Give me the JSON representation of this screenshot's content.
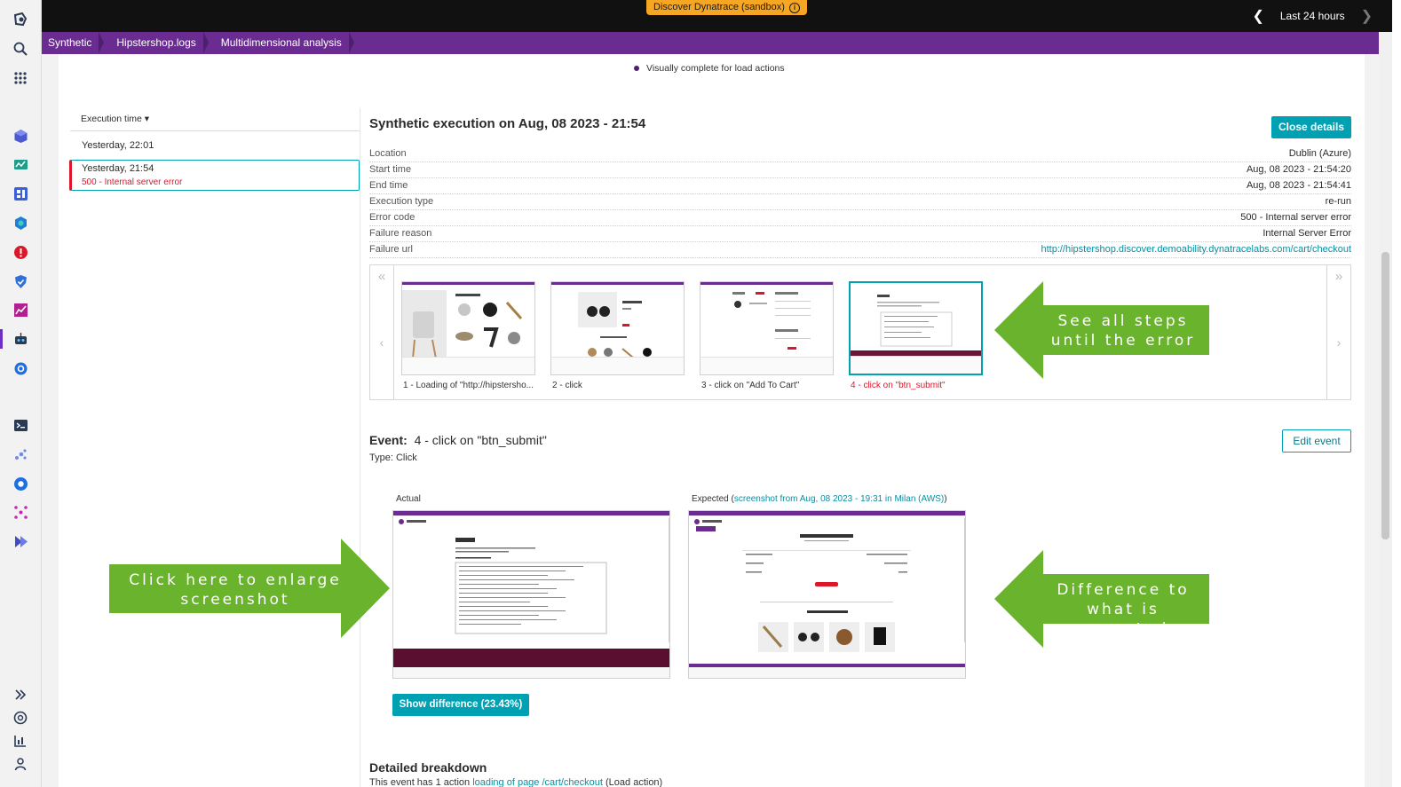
{
  "topbar": {
    "banner_label": "Discover Dynatrace (sandbox)",
    "timeframe_label": "Last 24 hours"
  },
  "breadcrumb": [
    "Synthetic",
    "Hipstershop.logs",
    "Multidimensional analysis"
  ],
  "legend": {
    "label": "Visually complete for load actions"
  },
  "execution_list": {
    "sort_label": "Execution time ▾",
    "items": [
      {
        "time": "Yesterday, 22:01",
        "status": ""
      },
      {
        "time": "Yesterday, 21:54",
        "status": "500 - Internal server error",
        "selected": true
      }
    ]
  },
  "details": {
    "title": "Synthetic execution on Aug, 08 2023 - 21:54",
    "close_button": "Close details",
    "rows": [
      {
        "label": "Location",
        "value": "Dublin (Azure)"
      },
      {
        "label": "Start time",
        "value": "Aug, 08 2023 - 21:54:20"
      },
      {
        "label": "End time",
        "value": "Aug, 08 2023 - 21:54:41"
      },
      {
        "label": "Execution type",
        "value": "re-run"
      },
      {
        "label": "Error code",
        "value": "500 - Internal server error"
      },
      {
        "label": "Failure reason",
        "value": "Internal Server Error"
      },
      {
        "label": "Failure url",
        "value": "http://hipstershop.discover.demoability.dynatracelabs.com/cart/checkout"
      }
    ]
  },
  "steps": [
    {
      "caption": "1 - Loading of \"http://hipstersho...",
      "error": false
    },
    {
      "caption": "2 - click",
      "error": false
    },
    {
      "caption": "3 - click on \"Add To Cart\"",
      "error": false
    },
    {
      "caption": "4 - click on \"btn_submit\"",
      "error": true,
      "selected": true
    }
  ],
  "event": {
    "label": "Event:",
    "name": "4 - click on \"btn_submit\"",
    "type": "Type: Click",
    "edit_button": "Edit event",
    "actual_label": "Actual",
    "expected_prefix": "Expected (",
    "expected_link": "screenshot from Aug, 08 2023 - 19:31 in Milan (AWS)",
    "expected_suffix": ")",
    "diff_button": "Show difference (23.43%)"
  },
  "breakdown": {
    "title": "Detailed breakdown",
    "sub_prefix": "This event has 1 action ",
    "sub_link": "loading of page /cart/checkout",
    "sub_suffix": " (Load action)"
  },
  "callouts": {
    "steps": [
      "See all steps",
      "until the error"
    ],
    "enlarge": [
      "Click here to enlarge",
      "screenshot"
    ],
    "difference": [
      "Difference to",
      "what is expected"
    ]
  },
  "colors": {
    "accent": "#00a1b2",
    "breadcrumb": "#6a2c91",
    "error": "#dc172a",
    "callout": "#6ab42d",
    "banner": "#f5a623"
  },
  "icons": [
    "dynatrace-logo-icon",
    "search-icon",
    "apps-grid-icon",
    "cube-icon",
    "monitor-icon",
    "dashboard-icon",
    "kubernetes-icon",
    "alert-icon",
    "shield-icon",
    "chart-icon",
    "synthetic-robot-icon",
    "settings-cog-icon",
    "terminal-icon",
    "analysis-icon",
    "cloud-icon",
    "network-icon",
    "deploy-icon",
    "expand-icon",
    "help-icon",
    "report-icon",
    "user-icon"
  ]
}
